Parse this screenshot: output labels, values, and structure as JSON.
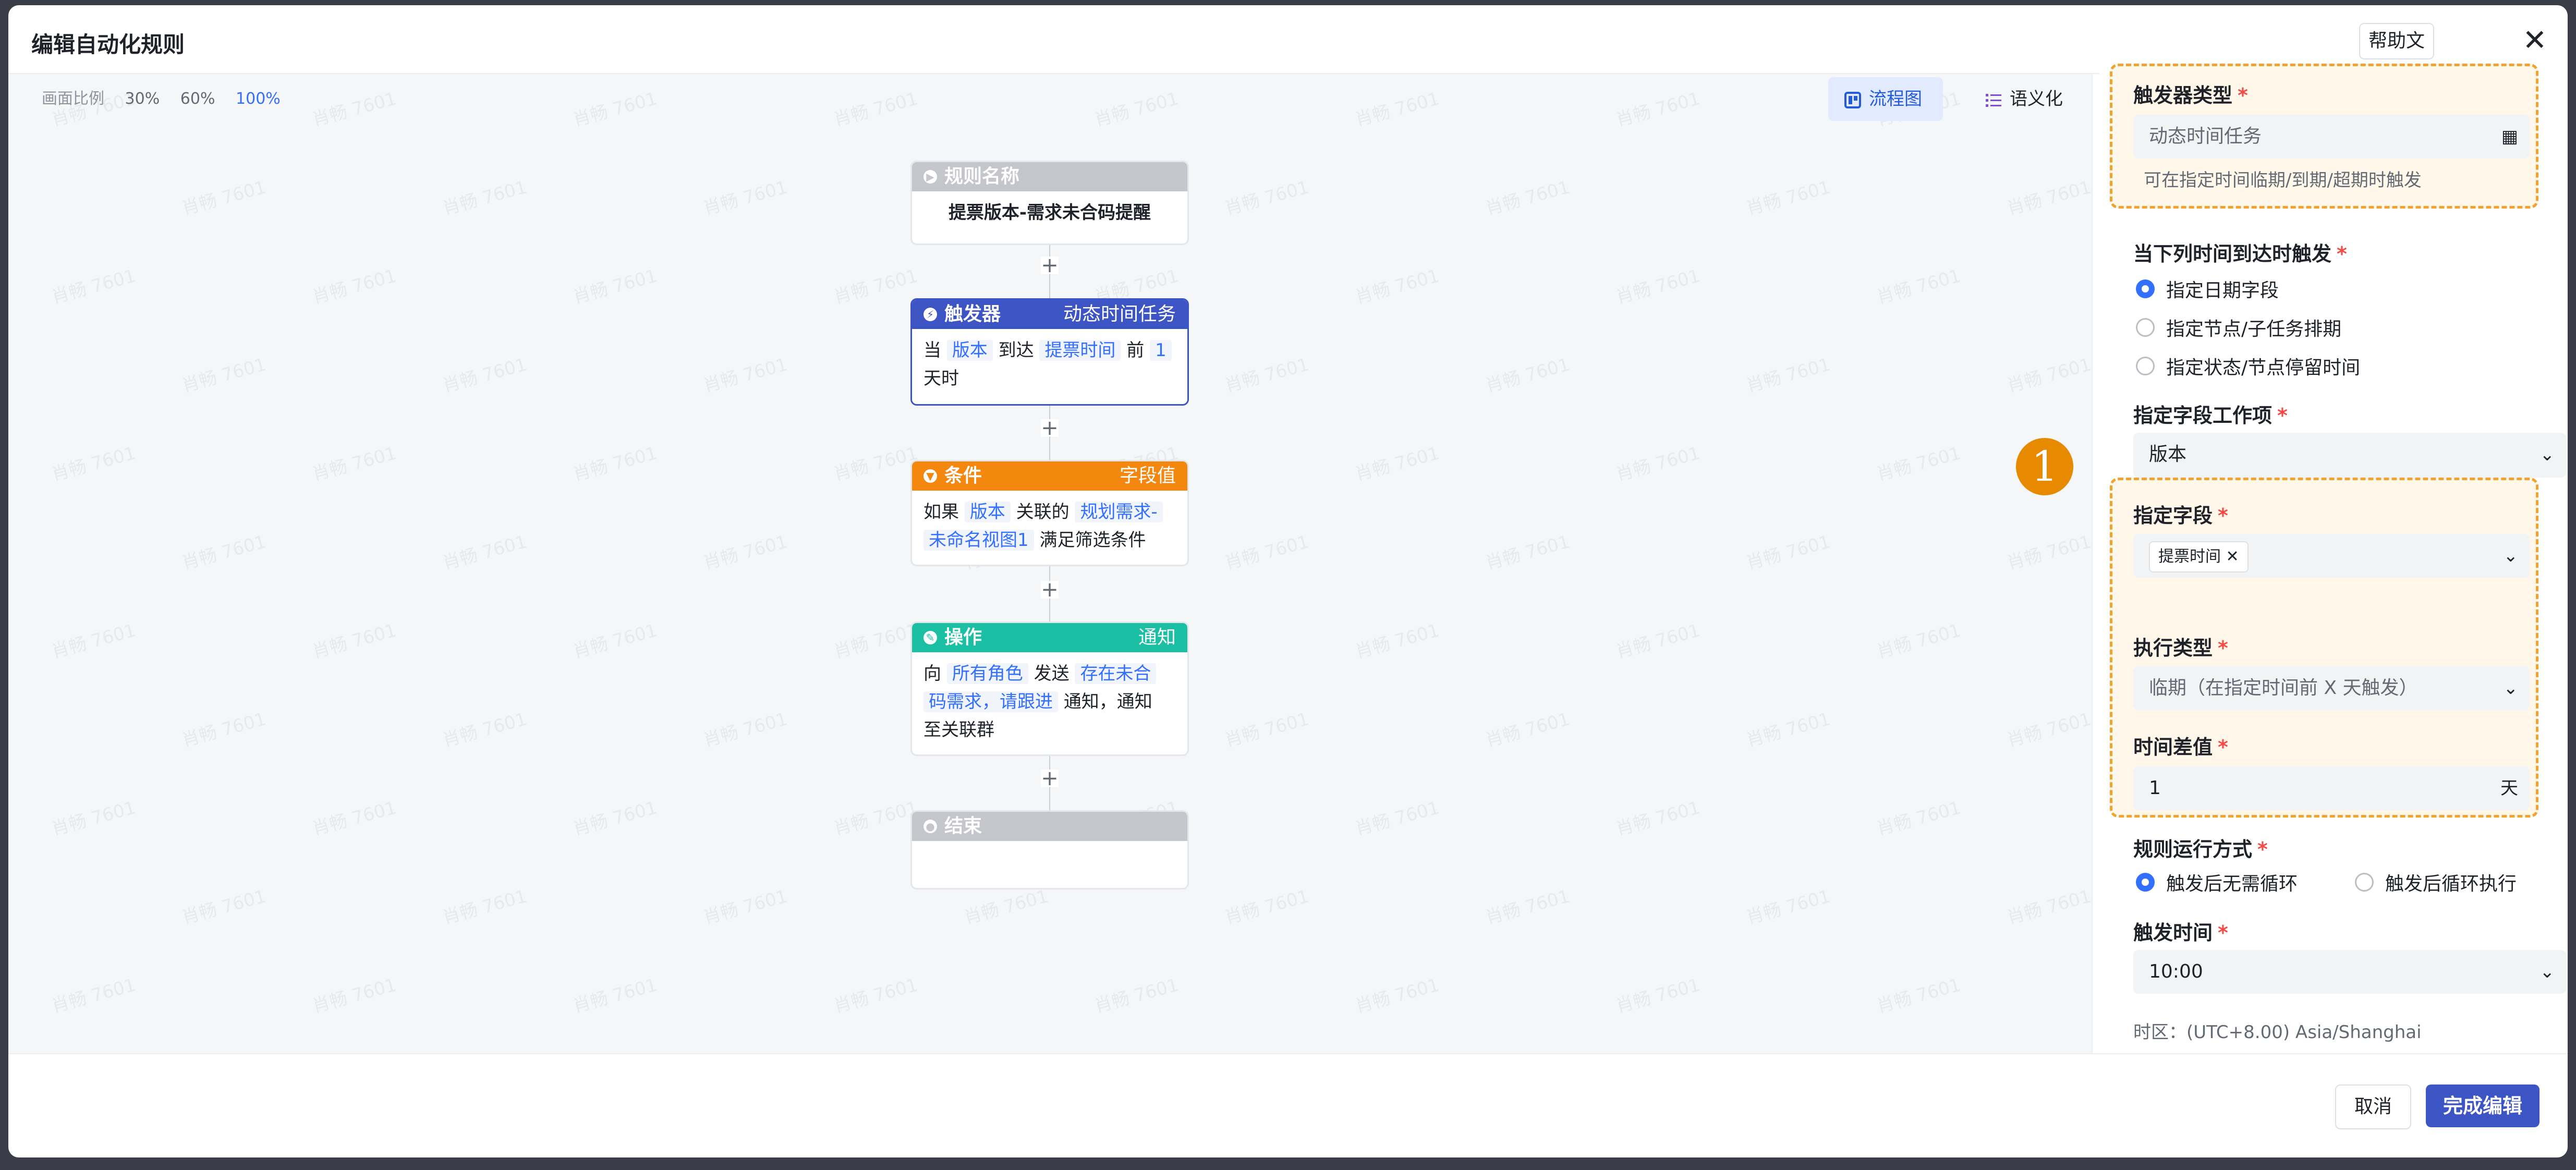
{
  "dialog": {
    "title": "编辑自动化规则",
    "help_label": "帮助文档",
    "close_label": "✕"
  },
  "canvas": {
    "scale_label": "画面比例",
    "zoom_options": [
      "30%",
      "60%",
      "100%"
    ],
    "view_flow_label": "流程图",
    "view_semantic_label": "语义化",
    "watermark": "肖畅 7601"
  },
  "flow": {
    "rule_name": {
      "header": "规则名称",
      "value": "提票版本-需求未合码提醒"
    },
    "trigger": {
      "header": "触发器",
      "type": "动态时间任务",
      "text1": "当",
      "chip1": "版本",
      "text2": "到达",
      "chip2": "提票时间",
      "text3": "前",
      "chip3": "1",
      "text4": "天时"
    },
    "condition": {
      "header": "条件",
      "type": "字段值",
      "text1": "如果",
      "chip1": "版本",
      "text2": "关联的",
      "chip2a": "规划需求-",
      "chip2b": "未命名视图1",
      "text3": "满足筛选条件"
    },
    "action": {
      "header": "操作",
      "type": "通知",
      "text1": "向",
      "chip1": "所有角色",
      "text2": "发送",
      "chip2a": "存在未合",
      "chip2b": "码需求，请跟进",
      "text3": "通知，通知",
      "text4": "至关联群"
    },
    "end": {
      "header": "结束"
    },
    "plus": "+"
  },
  "annotation": {
    "number": "1"
  },
  "panel": {
    "trigger_type_label": "触发器类型",
    "trigger_type_value": "动态时间任务",
    "trigger_type_hint": "可在指定时间临期/到期/超期时触发",
    "time_label": "当下列时间到达时触发",
    "time_options": [
      "指定日期字段",
      "指定节点/子任务排期",
      "指定状态/节点停留时间"
    ],
    "work_item_label": "指定字段工作项",
    "work_item_value": "版本",
    "field_label": "指定字段",
    "field_tag": "提票时间",
    "exec_type_label": "执行类型",
    "exec_type_value": "临期（在指定时间前 X 天触发）",
    "diff_label": "时间差值",
    "diff_value": "1",
    "diff_unit": "天",
    "run_mode_label": "规则运行方式",
    "run_mode_options": [
      "触发后无需循环",
      "触发后循环执行"
    ],
    "trigger_time_label": "触发时间",
    "trigger_time_value": "10:00",
    "timezone": "时区：(UTC+8.00) Asia/Shanghai",
    "required_mark": "*"
  },
  "footer": {
    "cancel_label": "取消",
    "done_label": "完成编辑"
  },
  "colors": {
    "trigger": "#3c54c4",
    "condition": "#f4880f",
    "action": "#1bbfa3",
    "neutral": "#c4c6cc",
    "accent": "#3370ff",
    "highlight": "#f0a32f"
  }
}
